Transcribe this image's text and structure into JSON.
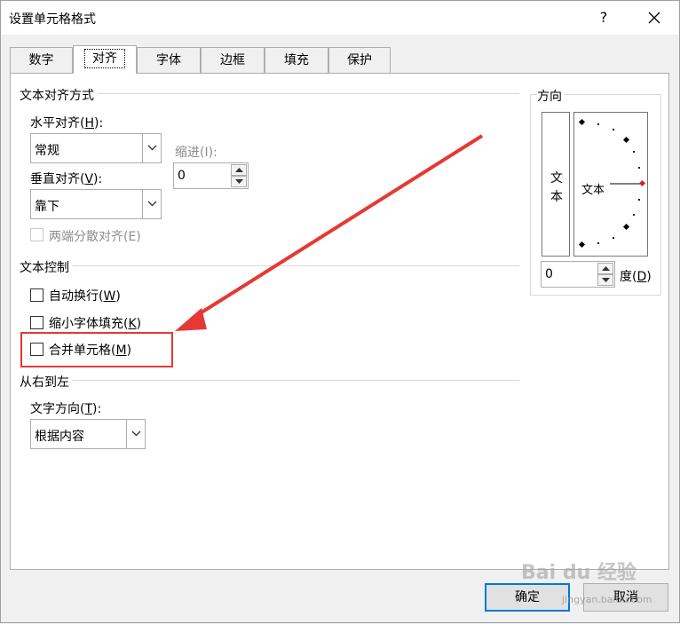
{
  "window": {
    "title": "设置单元格格式",
    "help": "?"
  },
  "tabs": [
    "数字",
    "对齐",
    "字体",
    "边框",
    "填充",
    "保护"
  ],
  "alignment": {
    "section": "文本对齐方式",
    "horizontal": {
      "label_pre": "水平对齐(",
      "key": "H",
      "label_post": "):",
      "value": "常规"
    },
    "indent": {
      "label": "缩进(I):",
      "value": "0"
    },
    "vertical": {
      "label_pre": "垂直对齐(",
      "key": "V",
      "label_post": "):",
      "value": "靠下"
    },
    "justify_distributed": "两端分散对齐(E)"
  },
  "text_control": {
    "section": "文本控制",
    "wrap": {
      "label_pre": "自动换行(",
      "key": "W",
      "label_post": ")"
    },
    "shrink": {
      "label_pre": "缩小字体填充(",
      "key": "K",
      "label_post": ")"
    },
    "merge": {
      "label_pre": "合并单元格(",
      "key": "M",
      "label_post": ")"
    }
  },
  "rtl": {
    "section": "从右到左",
    "direction": {
      "label_pre": "文字方向(",
      "key": "T",
      "label_post": "):",
      "value": "根据内容"
    }
  },
  "orientation": {
    "title": "方向",
    "vertical_text": "文本",
    "dial_text": "文本",
    "degrees_value": "0",
    "degrees_label_pre": "度(",
    "degrees_key": "D",
    "degrees_label_post": ")"
  },
  "buttons": {
    "ok": "确定",
    "cancel": "取消"
  },
  "watermark": {
    "main": "Bai du 经验",
    "sub": "jingyan.baidu.com"
  },
  "colors": {
    "annotation": "#e53935",
    "default_button_border": "#0078d7"
  }
}
